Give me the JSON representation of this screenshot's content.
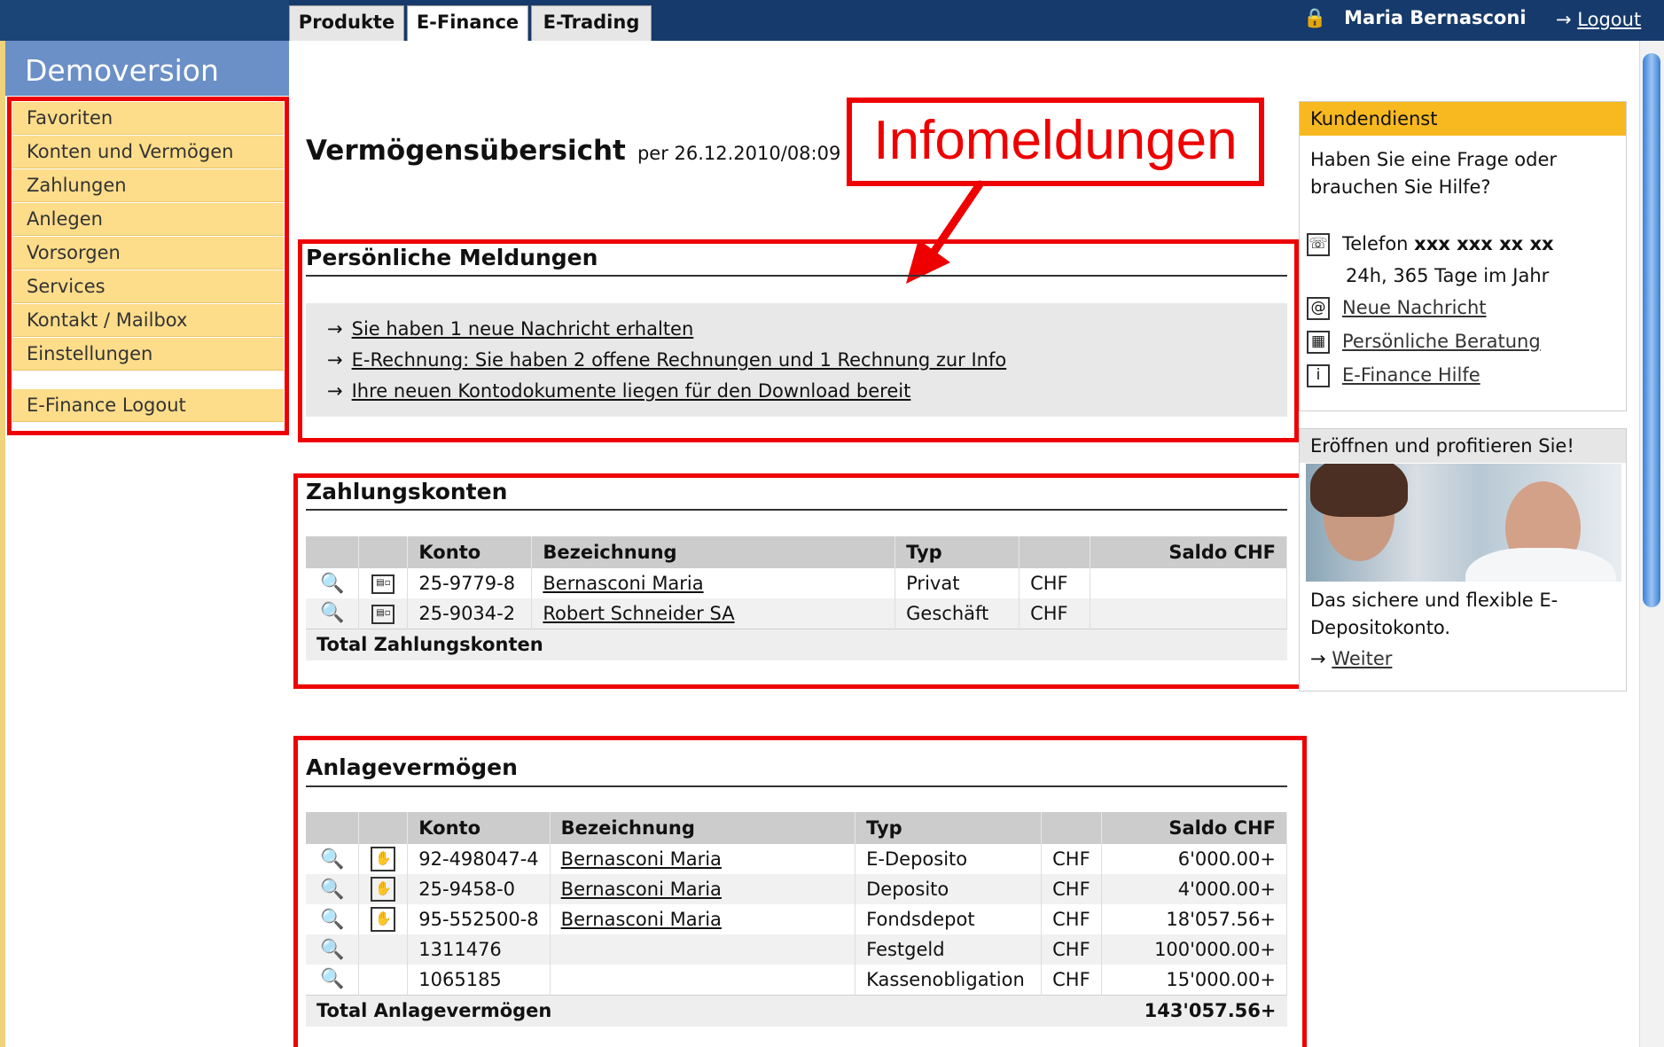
{
  "nav_tabs": [
    "Produkte",
    "E-Finance",
    "E-Trading"
  ],
  "user": {
    "lock_icon": "🔒",
    "name": "Maria Bernasconi",
    "logout_label": "Logout",
    "logout_arrow": "→"
  },
  "sidebar": {
    "title": "Demoversion",
    "items": [
      "Favoriten",
      "Konten und Vermögen",
      "Zahlungen",
      "Anlegen",
      "Vorsorgen",
      "Services",
      "Kontakt / Mailbox",
      "Einstellungen"
    ],
    "logout": "E-Finance Logout"
  },
  "page": {
    "title": "Vermögensübersicht",
    "date": "per 26.12.2010/08:09"
  },
  "callout": "Infomeldungen",
  "messages": {
    "title": "Persönliche Meldungen",
    "items": [
      "Sie haben 1 neue Nachricht erhalten",
      "E-Rechnung: Sie haben 2 offene Rechnungen und 1 Rechnung zur Info",
      "Ihre neuen Kontodokumente liegen für den Download bereit"
    ]
  },
  "payment": {
    "title": "Zahlungskonten",
    "headers": [
      "Konto",
      "Bezeichnung",
      "Typ",
      "Saldo CHF"
    ],
    "rows": [
      {
        "konto": "25-9779-8",
        "bezeichnung": "Bernasconi Maria",
        "typ": "Privat",
        "waehrung": "CHF",
        "saldo": ""
      },
      {
        "konto": "25-9034-2",
        "bezeichnung": "Robert Schneider SA",
        "typ": "Geschäft",
        "waehrung": "CHF",
        "saldo": ""
      }
    ],
    "total_label": "Total Zahlungskonten",
    "total_value": ""
  },
  "assets": {
    "title": "Anlagevermögen",
    "headers": [
      "Konto",
      "Bezeichnung",
      "Typ",
      "Saldo CHF"
    ],
    "rows": [
      {
        "konto": "92-498047-4",
        "bezeichnung": "Bernasconi Maria",
        "typ": "E-Deposito",
        "waehrung": "CHF",
        "saldo": "6'000.00+"
      },
      {
        "konto": "25-9458-0",
        "bezeichnung": "Bernasconi Maria",
        "typ": "Deposito",
        "waehrung": "CHF",
        "saldo": "4'000.00+"
      },
      {
        "konto": "95-552500-8",
        "bezeichnung": "Bernasconi Maria",
        "typ": "Fondsdepot",
        "waehrung": "CHF",
        "saldo": "18'057.56+"
      },
      {
        "konto": "1311476",
        "bezeichnung": "",
        "typ": "Festgeld",
        "waehrung": "CHF",
        "saldo": "100'000.00+"
      },
      {
        "konto": "1065185",
        "bezeichnung": "",
        "typ": "Kassenobligation",
        "waehrung": "CHF",
        "saldo": "15'000.00+"
      }
    ],
    "total_label": "Total Anlagevermögen",
    "total_value": "143'057.56+"
  },
  "service": {
    "title": "Kundendienst",
    "question": "Haben Sie eine Frage oder brauchen Sie Hilfe?",
    "phone_label": "Telefon",
    "phone_number": "xxx xxx xx xx",
    "hours": "24h, 365 Tage im Jahr",
    "links": [
      "Neue Nachricht",
      "Persönliche Beratung",
      "E-Finance Hilfe"
    ]
  },
  "promo": {
    "title": "Eröffnen und profitieren Sie!",
    "text": "Das sichere und flexible E-Depositokonto.",
    "link": "Weiter"
  },
  "colors": {
    "topbar": "#163a6b",
    "nav_item": "#fddd8a",
    "annotation": "#ee0000",
    "service_head": "#f8b920"
  }
}
